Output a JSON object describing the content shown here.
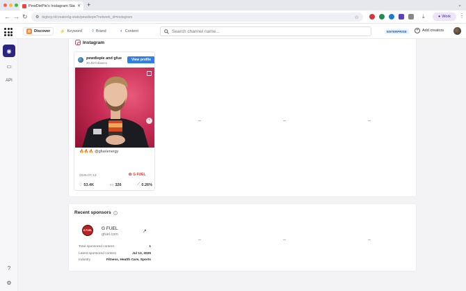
{
  "browser": {
    "tab_title": "PewDiePie's Instagram Stats",
    "url": "bigboy.nl/creator/ig-stats/pewdiepie?network_id=instagram",
    "work_label": "Work",
    "colors": {
      "close": "#ff5f57",
      "minimize": "#febc2e",
      "maximize": "#28c840"
    }
  },
  "app": {
    "nav": [
      {
        "label": "Discover",
        "icon": "discover-icon"
      },
      {
        "label": "Keyword",
        "icon": "bolt-icon"
      },
      {
        "label": "Brand",
        "icon": "brand-icon"
      },
      {
        "label": "Content",
        "icon": "content-icon"
      }
    ],
    "search_placeholder": "Search channel name...",
    "badge": "ENTERPRISE",
    "add_creators": "Add creators"
  },
  "sidebar": {
    "api_label": "API",
    "accent": "#2b2480"
  },
  "instagram": {
    "section_title": "Instagram",
    "post": {
      "author": "pewdiepie and gfue",
      "followers": "20.4M followers",
      "view_profile": "View profile",
      "caption": "🔥🔥🔥 @gfuelenergy",
      "date": "2025-07-13",
      "brand": "G FUEL",
      "likes": "53.4K",
      "comments": "326",
      "engagement": "0.26%"
    },
    "empty_slots": [
      "--",
      "--",
      "--"
    ]
  },
  "sponsors": {
    "title": "Recent sponsors",
    "logo_text": "G FUEL",
    "name": "G FUEL",
    "domain": "gfuel.com",
    "details": [
      {
        "key": "Total sponsored content",
        "value": "1"
      },
      {
        "key": "Latest sponsored content",
        "value": "Jul 13, 2025"
      },
      {
        "key": "Industry",
        "value": "Fitness, Health Care, Sports"
      }
    ],
    "empty_slots": [
      "--",
      "--",
      "--"
    ]
  }
}
